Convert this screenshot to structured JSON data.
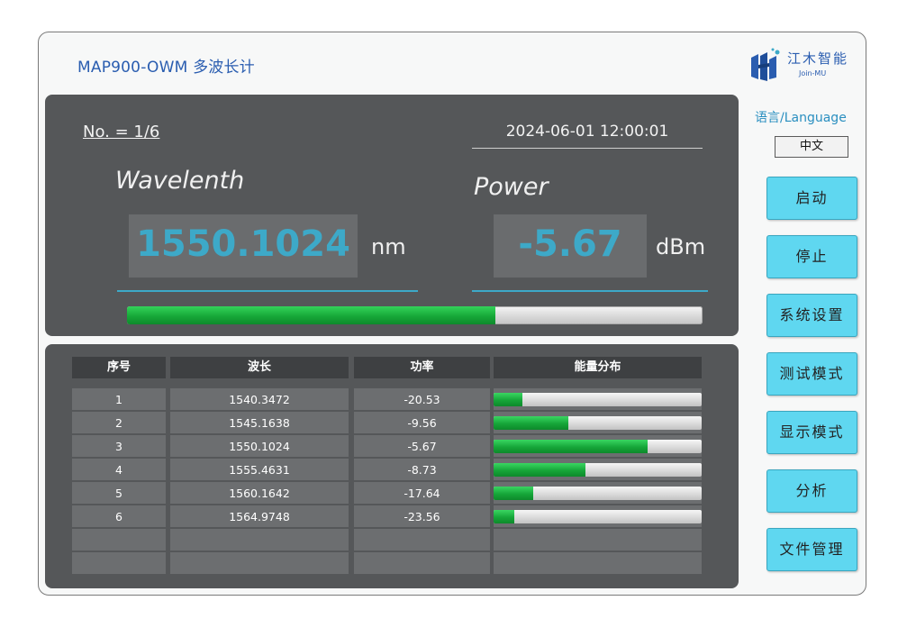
{
  "app": {
    "title": "MAP900-OWM 多波长计"
  },
  "logo": {
    "name": "江木智能",
    "sub": "Join-MU",
    "icon": "jm-logo-icon",
    "accent": "#2a5db0"
  },
  "measurement": {
    "index_label": "No. = 1/6",
    "datetime": "2024-06-01 12:00:01",
    "wavelength_title": "Wavelenth",
    "wavelength_value": "1550.1024",
    "wavelength_unit": "nm",
    "power_title": "Power",
    "power_value": "-5.67",
    "power_unit": "dBm",
    "energy_fraction": 0.64,
    "value_color": "#3da9c8"
  },
  "table": {
    "headers": [
      "序号",
      "波长",
      "功率",
      "能量分布"
    ],
    "rows": [
      {
        "no": "1",
        "wavelength": "1540.3472",
        "power": "-20.53",
        "energy": 0.14
      },
      {
        "no": "2",
        "wavelength": "1545.1638",
        "power": "-9.56",
        "energy": 0.36
      },
      {
        "no": "3",
        "wavelength": "1550.1024",
        "power": "-5.67",
        "energy": 0.74
      },
      {
        "no": "4",
        "wavelength": "1555.4631",
        "power": "-8.73",
        "energy": 0.44
      },
      {
        "no": "5",
        "wavelength": "1560.1642",
        "power": "-17.64",
        "energy": 0.19
      },
      {
        "no": "6",
        "wavelength": "1564.9748",
        "power": "-23.56",
        "energy": 0.1
      }
    ],
    "empty_rows": 2
  },
  "sidebar": {
    "language_label": "语言/Language",
    "language_value": "中文",
    "buttons": [
      "启动",
      "停止",
      "系统设置",
      "测试模式",
      "显示模式",
      "分析",
      "文件管理"
    ],
    "button_color": "#5fd7f0"
  }
}
